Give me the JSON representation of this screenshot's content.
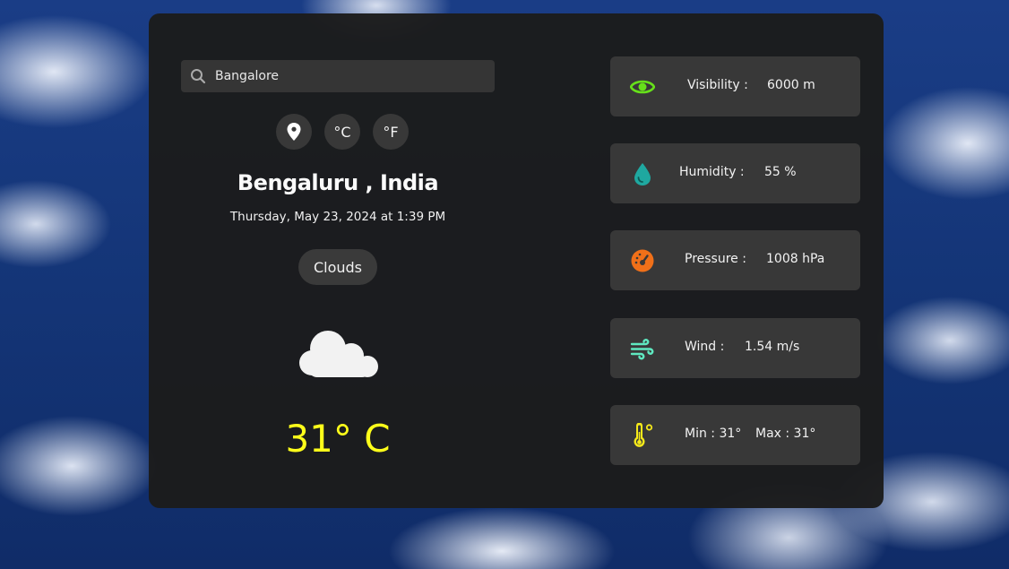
{
  "search": {
    "value": "Bangalore",
    "placeholder": ""
  },
  "units": {
    "celsius_label": "°C",
    "fahrenheit_label": "°F"
  },
  "location": {
    "city_country": "Bengaluru , India",
    "datetime": "Thursday, May 23, 2024 at 1:39 PM"
  },
  "condition": {
    "label": "Clouds",
    "icon": "cloud-icon"
  },
  "temperature": {
    "display": "31° C"
  },
  "stats": {
    "visibility": {
      "label": "Visibility :",
      "value": "6000 m",
      "icon": "eye-icon",
      "color": "#66e01a"
    },
    "humidity": {
      "label": "Humidity :",
      "value": "55 %",
      "icon": "water-drop-icon",
      "color": "#1fa8a0"
    },
    "pressure": {
      "label": "Pressure :",
      "value": "1008 hPa",
      "icon": "gauge-icon",
      "color": "#f07019"
    },
    "wind": {
      "label": "Wind :",
      "value": "1.54 m/s",
      "icon": "wind-icon",
      "color": "#5fe8c0"
    },
    "minmax": {
      "min": "Min : 31°",
      "max": "Max : 31°",
      "icon": "thermometer-icon",
      "color": "#f5e91a"
    }
  },
  "colors": {
    "temp_accent": "#ffff1a",
    "card_bg": "#1c1c1c",
    "tile_bg": "#383838"
  }
}
